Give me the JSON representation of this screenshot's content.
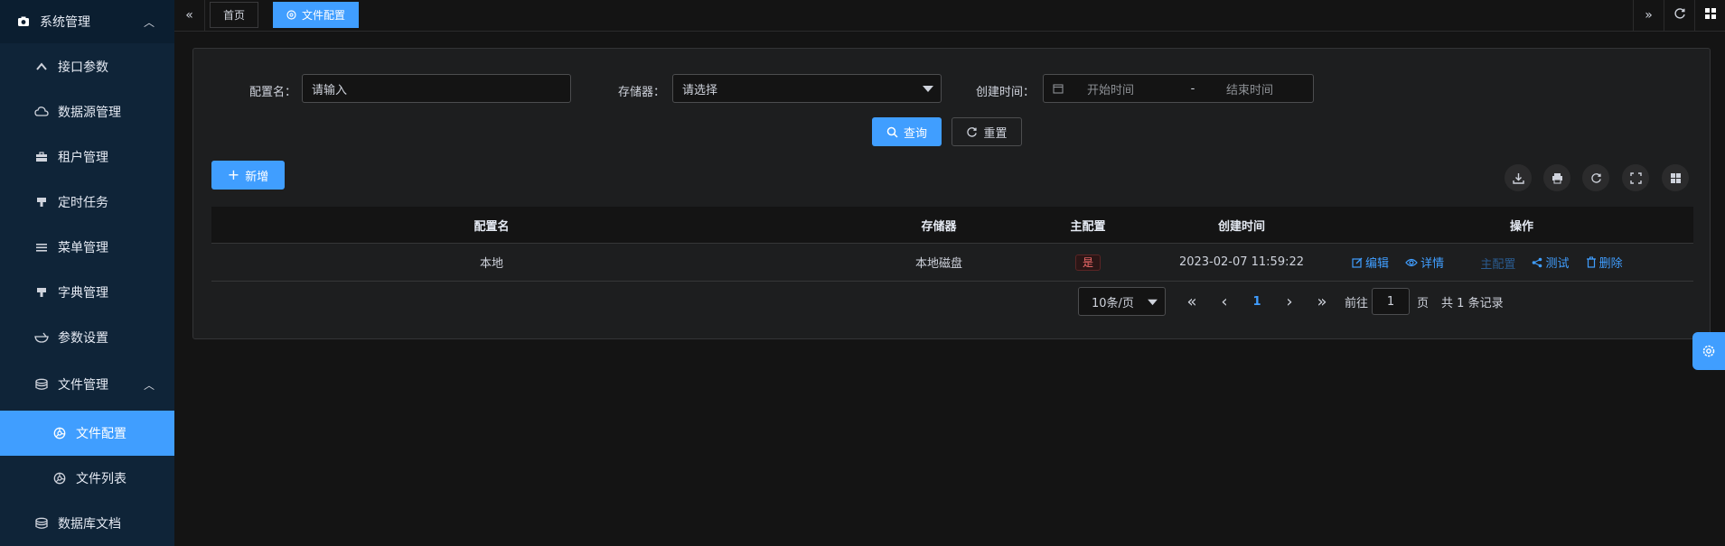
{
  "sidebar": {
    "root": {
      "label": "系统管理",
      "icon": "camera-icon"
    },
    "items": [
      {
        "label": "接口参数",
        "icon": "chevron-up-icon"
      },
      {
        "label": "数据源管理",
        "icon": "cloud-icon"
      },
      {
        "label": "租户管理",
        "icon": "briefcase-icon"
      },
      {
        "label": "定时任务",
        "icon": "stamp-icon"
      },
      {
        "label": "菜单管理",
        "icon": "menu-icon"
      },
      {
        "label": "字典管理",
        "icon": "stamp-icon"
      },
      {
        "label": "参数设置",
        "icon": "bowl-icon"
      },
      {
        "label": "文件管理",
        "icon": "database-icon"
      }
    ],
    "file_children": [
      {
        "label": "文件配置",
        "icon": "aperture-icon"
      },
      {
        "label": "文件列表",
        "icon": "aperture-icon"
      }
    ],
    "last_item": {
      "label": "数据库文档",
      "icon": "database-icon"
    }
  },
  "tabs": [
    {
      "label": "首页"
    },
    {
      "label": "文件配置"
    }
  ],
  "search": {
    "name_label": "配置名",
    "name_placeholder": "请输入",
    "storage_label": "存储器",
    "storage_placeholder": "请选择",
    "time_label": "创建时间",
    "start_placeholder": "开始时间",
    "range_sep": "-",
    "end_placeholder": "结束时间",
    "query_label": "查询",
    "reset_label": "重置"
  },
  "toolbar": {
    "add_label": "新增"
  },
  "table": {
    "columns": [
      "配置名",
      "存储器",
      "主配置",
      "创建时间",
      "操作"
    ],
    "rows": [
      {
        "name": "本地",
        "storage": "本地磁盘",
        "master": "是",
        "created": "2023-02-07 11:59:22",
        "actions": [
          "编辑",
          "详情",
          "主配置",
          "测试",
          "删除"
        ]
      }
    ]
  },
  "pagination": {
    "page_size": "10条/页",
    "current_page": "1",
    "goto_label": "前往",
    "goto_value": "1",
    "page_unit": "页",
    "total_label": "共 1 条记录"
  },
  "colors": {
    "accent": "#409eff",
    "danger": "#f56c6c",
    "sidebar_bg": "#0f2438"
  }
}
